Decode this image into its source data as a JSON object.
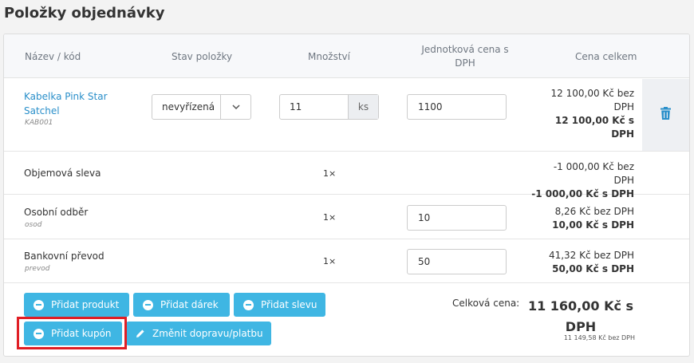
{
  "page_title": "Položky objednávky",
  "columns": {
    "name": "Název / kód",
    "status": "Stav položky",
    "quantity": "Množství",
    "unit_price_line1": "Jednotková cena s",
    "unit_price_line2": "DPH",
    "total": "Cena celkem"
  },
  "product": {
    "name_line1": "Kabelka Pink Star",
    "name_line2": "Satchel",
    "code": "KAB001",
    "status": "nevyřízená",
    "quantity": "11",
    "unit": "ks",
    "unit_price": "1100",
    "price_excl_line1": "12 100,00 Kč bez",
    "price_excl_line2": "DPH",
    "price_incl": "12 100,00 Kč s DPH"
  },
  "extras": [
    {
      "label": "Objemová sleva",
      "sub": "",
      "multiplier": "1×",
      "unit_price": "",
      "price_excl": "-1 000,00 Kč bez DPH",
      "price_incl": "-1 000,00 Kč s DPH"
    },
    {
      "label": "Osobní odběr",
      "sub": "osod",
      "multiplier": "1×",
      "unit_price": "10",
      "price_excl": "8,26 Kč bez DPH",
      "price_incl": "10,00 Kč s DPH"
    },
    {
      "label": "Bankovní převod",
      "sub": "prevod",
      "multiplier": "1×",
      "unit_price": "50",
      "price_excl": "41,32 Kč bez DPH",
      "price_incl": "50,00 Kč s DPH"
    }
  ],
  "buttons": {
    "add_product": "Přidat produkt",
    "add_gift": "Přidat dárek",
    "add_discount": "Přidat slevu",
    "add_coupon": "Přidat kupón",
    "change_shipping": "Změnit dopravu/platbu"
  },
  "summary": {
    "label": "Celková cena:",
    "total_line1": "11 160,00 Kč s",
    "total_line2": "DPH",
    "total_excl": "11 149,58 Kč bez DPH"
  },
  "colors": {
    "accent": "#3fb6e3",
    "link": "#2a8fca",
    "highlight": "#e01e25"
  }
}
